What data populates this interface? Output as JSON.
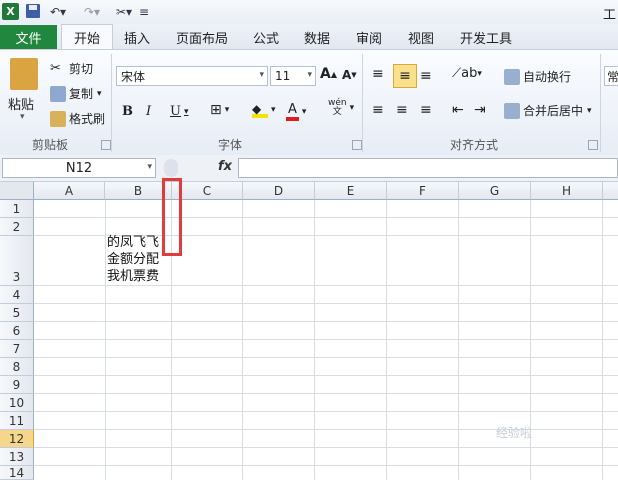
{
  "window": {
    "title": "工"
  },
  "ribbon": {
    "tabs": [
      "开始",
      "插入",
      "页面布局",
      "公式",
      "数据",
      "审阅",
      "视图",
      "开发工具"
    ],
    "file_tab": "文件",
    "clipboard": {
      "paste": "粘贴",
      "cut": "剪切",
      "copy": "复制",
      "format_painter": "格式刷",
      "group_label": "剪贴板"
    },
    "font": {
      "name": "宋体",
      "size": "11",
      "bold": "B",
      "italic": "I",
      "underline": "U",
      "grow": "A",
      "shrink": "A",
      "font_color": "A",
      "phonetic": "wén\n文",
      "group_label": "字体"
    },
    "alignment": {
      "wrap_text": "自动换行",
      "merge_center": "合并后居中",
      "group_label": "对齐方式"
    },
    "number": {
      "format": "常"
    }
  },
  "formula_bar": {
    "name_box": "N12",
    "fx": "fx",
    "value": ""
  },
  "grid": {
    "columns": [
      "A",
      "B",
      "C",
      "D",
      "E",
      "F",
      "G",
      "H"
    ],
    "rows": [
      "1",
      "2",
      "3",
      "4",
      "5",
      "6",
      "7",
      "8",
      "9",
      "10",
      "11",
      "12",
      "13",
      "14"
    ],
    "selected_row": "12",
    "cell_b3": "的凤飞飞\n金额分配\n我机票费"
  },
  "watermark": "经验啦"
}
